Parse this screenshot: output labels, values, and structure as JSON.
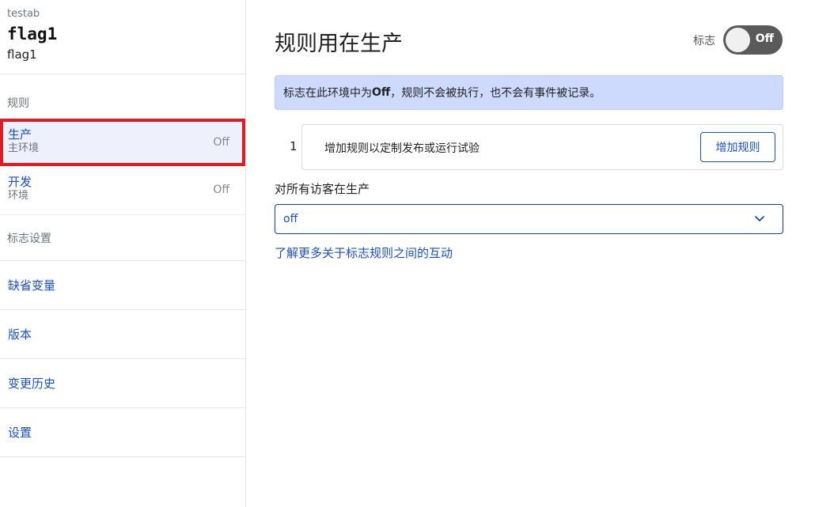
{
  "sidebar": {
    "project_name": "testab",
    "flag_key": "flag1",
    "flag_name": "flag1",
    "rules_section_label": "规则",
    "environments": [
      {
        "title": "生产",
        "subtitle": "主环境",
        "status": "Off",
        "active": true
      },
      {
        "title": "开发",
        "subtitle": "环境",
        "status": "Off",
        "active": false
      }
    ],
    "settings_section_label": "标志设置",
    "nav_links": [
      "缺省变量",
      "版本",
      "变更历史",
      "设置"
    ]
  },
  "main": {
    "title": "规则用在生产",
    "toggle_label": "标志",
    "toggle_state": "Off",
    "banner_prefix": "标志在此环境中为",
    "banner_bold": "Off",
    "banner_suffix": "，规则不会被执行，也不会有事件被记录。",
    "rule_index": "1",
    "rule_prompt": "增加规则以定制发布或运行试验",
    "add_rule_label": "增加规则",
    "fallthrough_label": "对所有访客在生产",
    "fallthrough_value": "off",
    "learn_more_link": "了解更多关于标志规则之间的互动"
  },
  "colors": {
    "accent": "#1a4fc9",
    "banner_bg": "#cdd9fd",
    "active_env_bg": "#eef0fc",
    "highlight_outline": "#e01b24",
    "toggle_off_bg": "#5a5a5a"
  }
}
